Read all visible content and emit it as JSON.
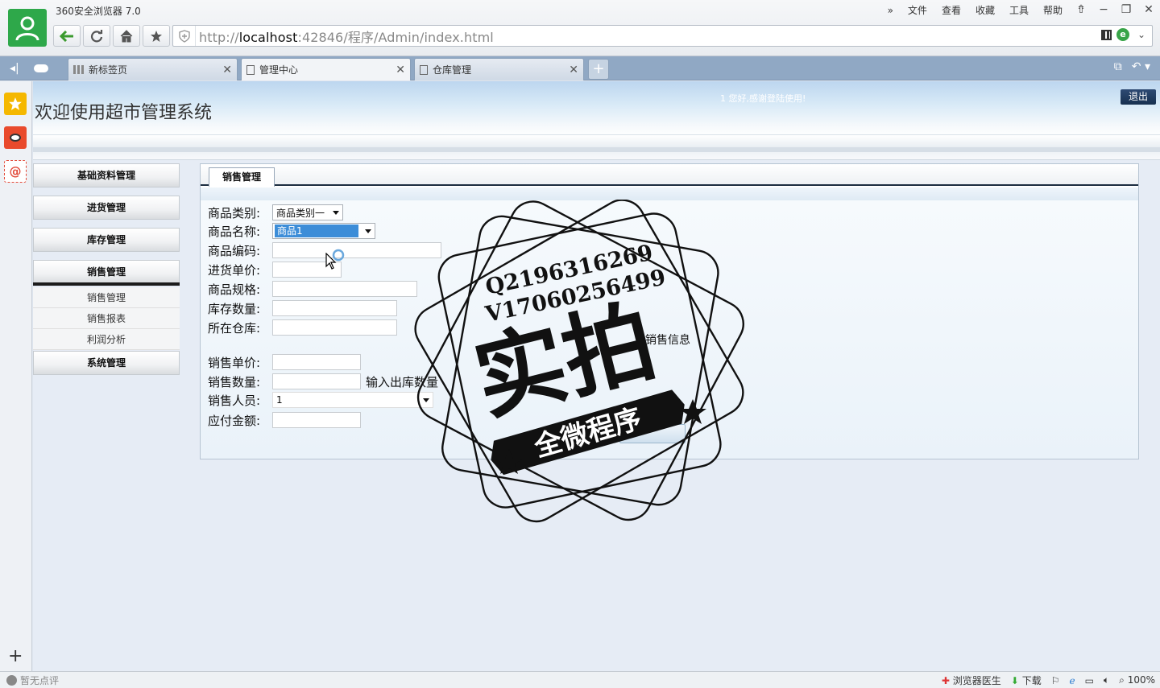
{
  "browser": {
    "app_title": "360安全浏览器 7.0",
    "menu": [
      "文件",
      "查看",
      "收藏",
      "工具",
      "帮助"
    ],
    "url_prefix": "http://",
    "url_host": "localhost",
    "url_rest": ":42846/程序/Admin/index.html",
    "tabs": [
      {
        "label": "新标签页"
      },
      {
        "label": "管理中心"
      },
      {
        "label": "仓库管理"
      }
    ],
    "tab_new": "+",
    "status_left": "暂无点评",
    "status_doctor": "浏览器医生",
    "status_download": "下载",
    "status_zoom": "100%"
  },
  "page": {
    "welcome": "欢迎使用超市管理系统",
    "greeting": "1 您好,感谢登陆使用!",
    "logout": "退出",
    "menu": {
      "basic": "基础资料管理",
      "purchase": "进货管理",
      "stock": "库存管理",
      "sales": "销售管理",
      "sales_items": [
        "销售管理",
        "销售报表",
        "利润分析"
      ],
      "system": "系统管理"
    },
    "panel_tab": "销售管理",
    "form": {
      "category_label": "商品类别:",
      "category_value": "商品类别一",
      "name_label": "商品名称:",
      "name_value": "商品1",
      "code_label": "商品编码:",
      "code_value": "",
      "purchase_price_label": "进货单价:",
      "purchase_price_value": "",
      "spec_label": "商品规格:",
      "spec_value": "",
      "stock_qty_label": "库存数量:",
      "stock_qty_value": "",
      "warehouse_label": "所在仓库:",
      "warehouse_value": "",
      "sale_price_label": "销售单价:",
      "sale_price_value": "",
      "sale_qty_label": "销售数量:",
      "sale_qty_value": "",
      "sale_qty_hint": "输入出库数量",
      "seller_label": "销售人员:",
      "seller_value": "1",
      "payable_label": "应付金额:",
      "payable_value": ""
    },
    "partial_info_text": "销售信息"
  },
  "watermark": {
    "line1": "Q2196316269",
    "line2": "V17060256499",
    "big": "实拍",
    "banner": "全微程序"
  },
  "colors": {
    "avatar_green": "#2ea84a",
    "tabbar_blue": "#90a8c4",
    "select_highlight": "#3c8dd8",
    "logout_navy": "#1f3a60"
  }
}
